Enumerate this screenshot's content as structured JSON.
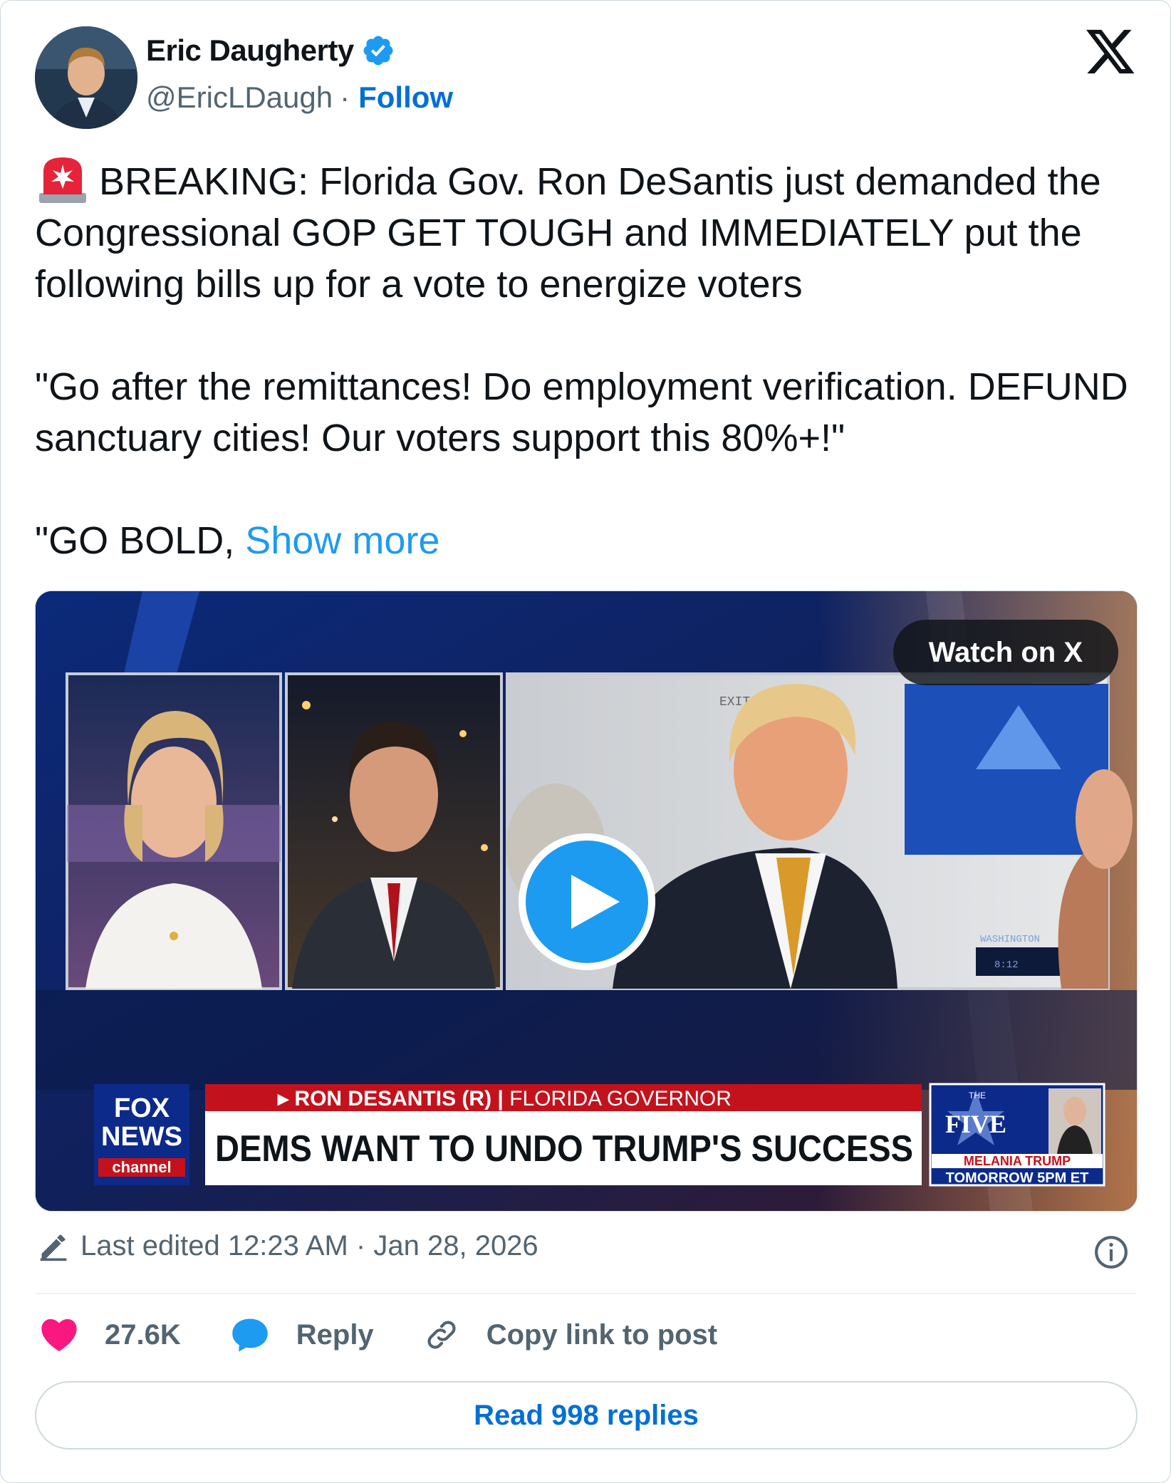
{
  "author": {
    "name": "Eric Daugherty",
    "handle": "@EricLDaugh",
    "separator": "·",
    "follow_label": "Follow"
  },
  "tweet": {
    "paragraph1": "BREAKING: Florida Gov. Ron DeSantis just demanded the Congressional GOP GET TOUGH and IMMEDIATELY put the following bills up for a vote to energize voters",
    "paragraph2": "\"Go after the remittances! Do employment verification. DEFUND sanctuary cities! Our voters support this 80%+!\"",
    "paragraph3": "\"GO BOLD,",
    "show_more": "Show more"
  },
  "media": {
    "watch_label": "Watch on X",
    "overlay_exit": "EXIT",
    "overlay_location": "WASHINGTON",
    "overlay_time": "8:12",
    "chyron_tag": "RON DESANTIS (R)",
    "chyron_role": "FLORIDA GOVERNOR",
    "chyron_headline": "DEMS WANT TO UNDO TRUMP'S SUCCESS",
    "network_line1": "FOX",
    "network_line2": "NEWS",
    "network_line3": "channel",
    "promo_show": "FIVE",
    "promo_show_prefix": "THE",
    "promo_guest": "MELANIA TRUMP",
    "promo_time": "TOMORROW 5PM ET"
  },
  "meta": {
    "edited": "Last edited 12:23 AM · Jan 28, 2026"
  },
  "actions": {
    "likes": "27.6K",
    "reply_label": "Reply",
    "copy_label": "Copy link to post"
  },
  "replies_button": "Read 998 replies",
  "colors": {
    "accent": "#1d9bf0",
    "link": "#006fd6",
    "like": "#f91880",
    "muted": "#536471"
  }
}
